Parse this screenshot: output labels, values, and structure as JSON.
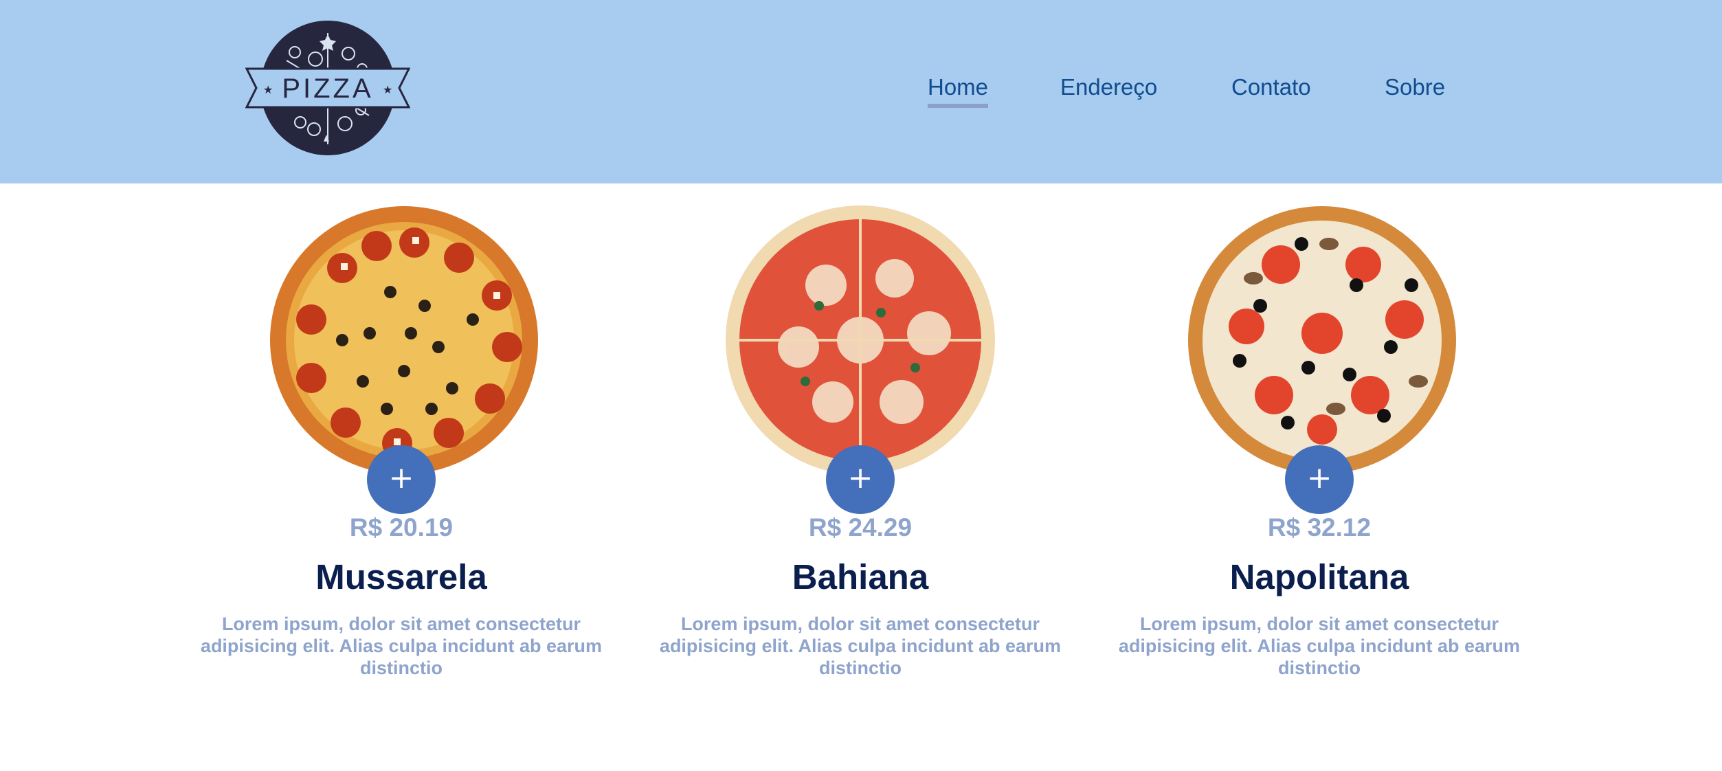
{
  "logo": {
    "text": "PIZZA"
  },
  "nav": {
    "items": [
      {
        "label": "Home",
        "active": true
      },
      {
        "label": "Endereço",
        "active": false
      },
      {
        "label": "Contato",
        "active": false
      },
      {
        "label": "Sobre",
        "active": false
      }
    ]
  },
  "colors": {
    "header_bg": "#a8cbf0",
    "nav_text": "#0f4d8f",
    "button": "#436fbb",
    "price": "#8ea4cc",
    "title": "#0b1f4f"
  },
  "cards": [
    {
      "add_label": "+",
      "price": "R$ 20.19",
      "name": "Mussarela",
      "description": "Lorem ipsum, dolor sit amet consectetur adipisicing elit. Alias culpa incidunt ab earum distinctio"
    },
    {
      "add_label": "+",
      "price": "R$ 24.29",
      "name": "Bahiana",
      "description": "Lorem ipsum, dolor sit amet consectetur adipisicing elit. Alias culpa incidunt ab earum distinctio"
    },
    {
      "add_label": "+",
      "price": "R$ 32.12",
      "name": "Napolitana",
      "description": "Lorem ipsum, dolor sit amet consectetur adipisicing elit. Alias culpa incidunt ab earum distinctio"
    }
  ]
}
